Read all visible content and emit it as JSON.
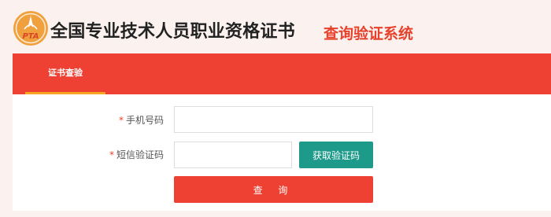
{
  "header": {
    "logo_text": "PTA",
    "title": "全国专业技术人员职业资格证书",
    "subtitle": "查询验证系统"
  },
  "nav": {
    "tabs": [
      {
        "label": "证书查验",
        "active": true
      }
    ]
  },
  "form": {
    "phone": {
      "required_mark": "*",
      "label": "手机号码",
      "value": "",
      "placeholder": ""
    },
    "sms_code": {
      "required_mark": "*",
      "label": "短信验证码",
      "value": "",
      "placeholder": ""
    },
    "get_code_label": "获取验证码",
    "query_label": "查 询"
  },
  "colors": {
    "brand_red": "#ee4133",
    "accent_orange": "#f6a623",
    "teal": "#1d9a8a",
    "background": "#fbf2f0"
  }
}
